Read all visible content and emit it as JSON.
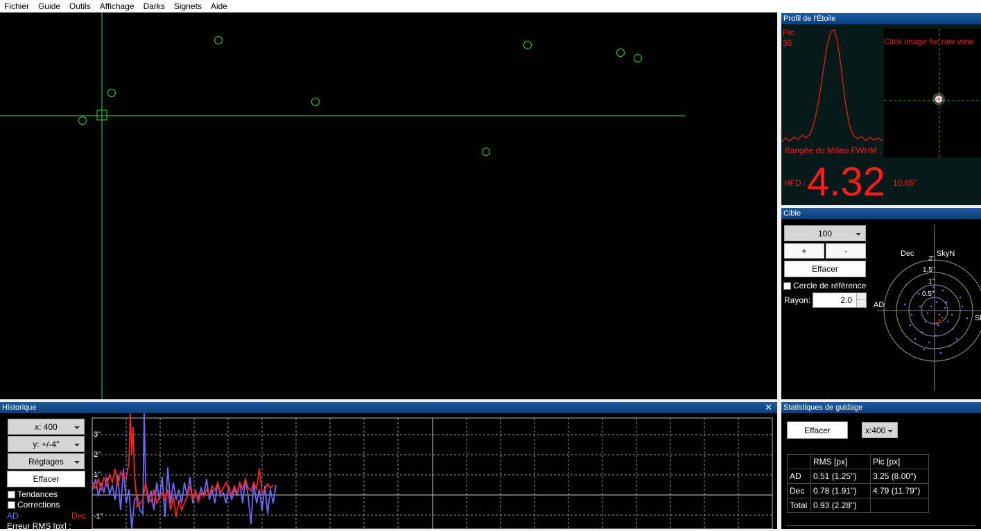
{
  "menu": [
    "Fichier",
    "Guide",
    "Outils",
    "Affichage",
    "Darks",
    "Signets",
    "Aide"
  ],
  "star_profile": {
    "title": "Profil de l'Étoile",
    "peak_label": "Pic",
    "peak_value": "36",
    "click_hint": "Click image for raw view",
    "mid_row_label": "Rangée du Milieu FWHM :",
    "hfd_label": "HFD :",
    "hfd_value": "4.32",
    "hfd_arcsec": "10.65\""
  },
  "target": {
    "title": "Cible",
    "length_value": "100",
    "plus_label": "+",
    "minus_label": "-",
    "clear_label": "Effacer",
    "ref_circle_label": "Cercle de référence",
    "radius_label": "Rayon:",
    "radius_value": "2.0",
    "axis_dec": "Dec",
    "axis_skyn": "SkyN",
    "axis_ad": "AD",
    "axis_right": "Sk",
    "rings": [
      "2\"",
      "1.5\"",
      "1\"",
      "0.5\""
    ]
  },
  "history": {
    "title": "Historique",
    "x_scale": "x: 400",
    "y_scale": "y: +/-4''",
    "settings_label": "Réglages",
    "clear_label": "Effacer",
    "trends_label": "Tendances",
    "corrections_label": "Corrections",
    "legend_ra": "AD",
    "legend_dec": "Dec",
    "rms_label": "Erreur RMS [px] :",
    "y_ticks": [
      "3\"",
      "2\"",
      "1\"",
      "-1\""
    ],
    "ra_color": "#6b6bff",
    "dec_color": "#ff2020"
  },
  "stats": {
    "title": "Statistiques de guidage",
    "clear_label": "Effacer",
    "x_scale": "x:400",
    "headers": [
      "",
      "RMS [px]",
      "Pic [px]"
    ],
    "rows": [
      [
        "AD",
        "0.51 (1.25'')",
        "3.25 (8.00'')"
      ],
      [
        "Dec",
        "0.78 (1.91'')",
        "4.79 (11.79'')"
      ],
      [
        "Total",
        "0.93 (2.28'')",
        ""
      ]
    ]
  },
  "colors": {
    "panel_title": "#0b3f7c",
    "star_marker": "#33dd33",
    "profile_red": "#ff1a1a"
  }
}
